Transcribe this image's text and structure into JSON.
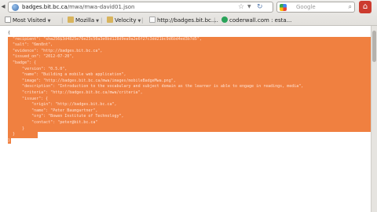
{
  "browser": {
    "url_domain": "badges.bit.bc.ca",
    "url_path": "/mwa/mwa-david01.json",
    "search_engine": "Google"
  },
  "bookmarks": [
    {
      "label": "Most Visited",
      "has_arrow": true
    },
    {
      "label": "Mozilla",
      "has_arrow": true
    },
    {
      "label": "Velocity",
      "has_arrow": true
    },
    {
      "label": "http://badges.bit.bc...."
    },
    {
      "label": "coderwall.com : esta..."
    }
  ],
  "json_lines": [
    "{",
    "  \"recipient\": \"sha256$3d4825e76e23c50a3e0bd128d9ea9a2e6f27c3dd21bc9d6bd4ed3b7d5\",",
    "  \"salt\": \"6mn0nt\",",
    "  \"evidence\": \"http://badges.bit.bc.ca\",",
    "  \"issued_on\": \"2012-07-20\",",
    "  \"badge\": {",
    "      \"version\": \"0.5.0\",",
    "      \"name\": \"Building a mobile web application\",",
    "      \"image\": \"http://badges.bit.bc.ca/mwa/images/mobileBadgeMwa.png\",",
    "      \"description\": \"Introduction to the vocabulary and subject domain as the learner is able to engage in readings, media\",",
    "      \"criteria\": \"http://badges.bit.bc.ca/mwa/criteria\",",
    "      \"issuer\": {",
    "          \"origin\": \"http://badges.bit.bc.ca\",",
    "          \"name\": \"Peter Baumgartner\",",
    "          \"org\": \"Bowen Institute of Technology\",",
    "          \"contact\": \"peter@bit.bc.ca\"",
    "      }",
    "  }",
    "}"
  ]
}
